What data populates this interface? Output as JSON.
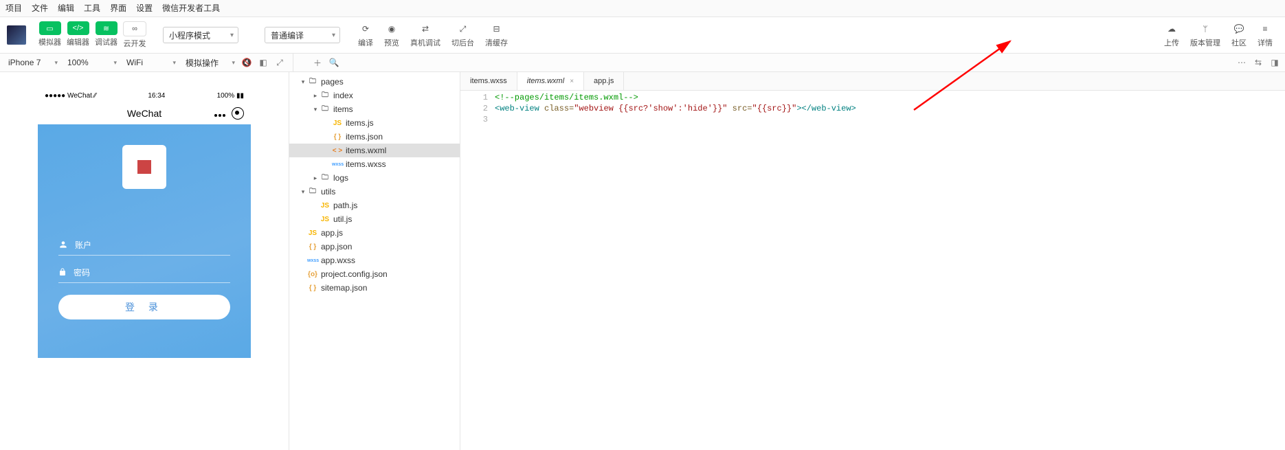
{
  "menu": [
    "项目",
    "文件",
    "编辑",
    "工具",
    "界面",
    "设置",
    "微信开发者工具"
  ],
  "toolbar": {
    "simulator": "模拟器",
    "editor": "编辑器",
    "debugger": "调试器",
    "cloud": "云开发",
    "mode": "小程序模式",
    "compile_mode": "普通编译",
    "compile": "编译",
    "preview": "预览",
    "remote": "真机调试",
    "switch": "切后台",
    "clear": "清缓存",
    "upload": "上传",
    "version": "版本管理",
    "community": "社区",
    "detail": "详情"
  },
  "subbar": {
    "device": "iPhone 7",
    "zoom": "100%",
    "network": "WiFi",
    "mock": "模拟操作"
  },
  "phone": {
    "carrier": "WeChat",
    "time": "16:34",
    "battery": "100%",
    "title": "WeChat",
    "account": "账户",
    "password": "密码",
    "login": "登 录"
  },
  "tree": [
    {
      "d": 0,
      "arrow": "▾",
      "ic": "folder",
      "t": "pages"
    },
    {
      "d": 1,
      "arrow": "▸",
      "ic": "folder",
      "t": "index"
    },
    {
      "d": 1,
      "arrow": "▾",
      "ic": "folder",
      "t": "items"
    },
    {
      "d": 2,
      "arrow": "",
      "ic": "js",
      "t": "items.js",
      "g": "JS"
    },
    {
      "d": 2,
      "arrow": "",
      "ic": "json",
      "t": "items.json",
      "g": "{ }"
    },
    {
      "d": 2,
      "arrow": "",
      "ic": "wxml",
      "t": "items.wxml",
      "g": "< >",
      "sel": true
    },
    {
      "d": 2,
      "arrow": "",
      "ic": "wxss",
      "t": "items.wxss",
      "g": "wxss"
    },
    {
      "d": 1,
      "arrow": "▸",
      "ic": "folder",
      "t": "logs"
    },
    {
      "d": 0,
      "arrow": "▾",
      "ic": "folder",
      "t": "utils"
    },
    {
      "d": 1,
      "arrow": "",
      "ic": "js",
      "t": "path.js",
      "g": "JS"
    },
    {
      "d": 1,
      "arrow": "",
      "ic": "js",
      "t": "util.js",
      "g": "JS"
    },
    {
      "d": 0,
      "arrow": "",
      "ic": "js",
      "t": "app.js",
      "g": "JS"
    },
    {
      "d": 0,
      "arrow": "",
      "ic": "json",
      "t": "app.json",
      "g": "{ }"
    },
    {
      "d": 0,
      "arrow": "",
      "ic": "wxss",
      "t": "app.wxss",
      "g": "wxss"
    },
    {
      "d": 0,
      "arrow": "",
      "ic": "json",
      "t": "project.config.json",
      "g": "{o}"
    },
    {
      "d": 0,
      "arrow": "",
      "ic": "json",
      "t": "sitemap.json",
      "g": "{ }"
    }
  ],
  "tabs": [
    {
      "label": "items.wxss",
      "active": false
    },
    {
      "label": "items.wxml",
      "active": true
    },
    {
      "label": "app.js",
      "active": false
    }
  ],
  "code": {
    "l1_comment": "<!--pages/items/items.wxml-->",
    "l2_tag_open": "<web-view",
    "l2_attr1": " class=",
    "l2_val1": "\"webview {{src?'show':'hide'}}\"",
    "l2_attr2": " src=",
    "l2_val2": "\"{{src}}\"",
    "l2_tag_mid": ">",
    "l2_tag_close": "</web-view>"
  }
}
